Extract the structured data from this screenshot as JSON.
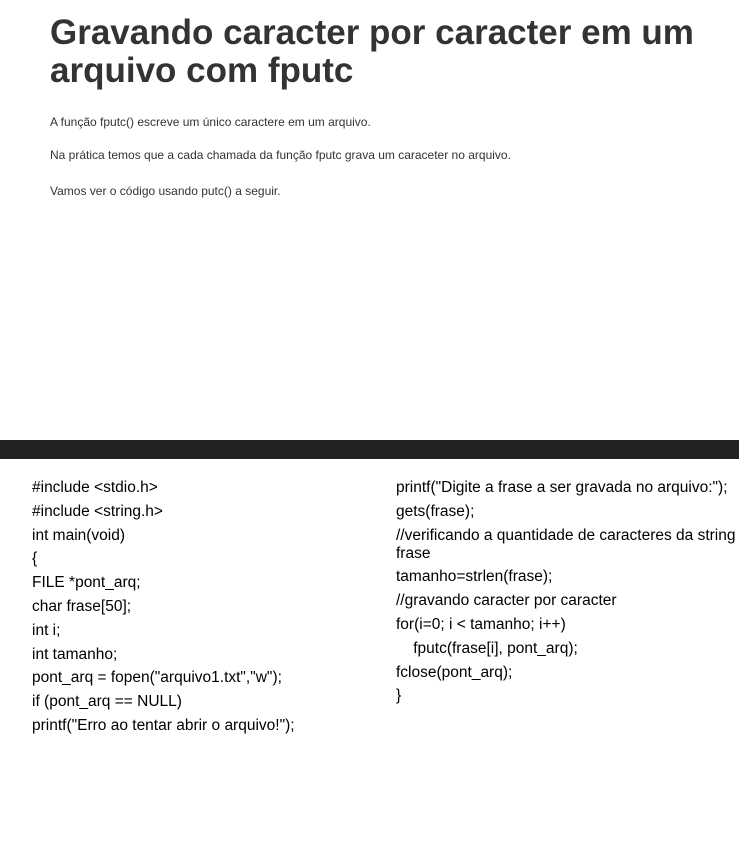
{
  "slide": {
    "title": "Gravando caracter por caracter em um arquivo com fputc",
    "paragraphs": [
      "A função fputc() escreve um único caractere em um arquivo.",
      "Na prática temos que a cada chamada da função fputc grava um caraceter no arquivo.",
      "Vamos ver o código usando putc() a seguir."
    ],
    "divider_color": "#222222"
  },
  "code": {
    "left_lines": [
      "#include <stdio.h>",
      "#include <string.h>",
      "int main(void)",
      "{",
      "FILE *pont_arq;",
      "char frase[50];",
      "int i;",
      "int tamanho;",
      "pont_arq = fopen(\"arquivo1.txt\",\"w\");",
      "if (pont_arq == NULL)",
      "printf(\"Erro ao tentar abrir o arquivo!\");"
    ],
    "right_lines": [
      "printf(\"Digite a frase a ser gravada no arquivo:\");",
      "gets(frase);",
      "//verificando a quantidade de caracteres da string frase",
      "tamanho=strlen(frase);",
      "//gravando caracter por caracter",
      "for(i=0; i < tamanho; i++)",
      "    fputc(frase[i], pont_arq);",
      "fclose(pont_arq);",
      "}"
    ]
  }
}
